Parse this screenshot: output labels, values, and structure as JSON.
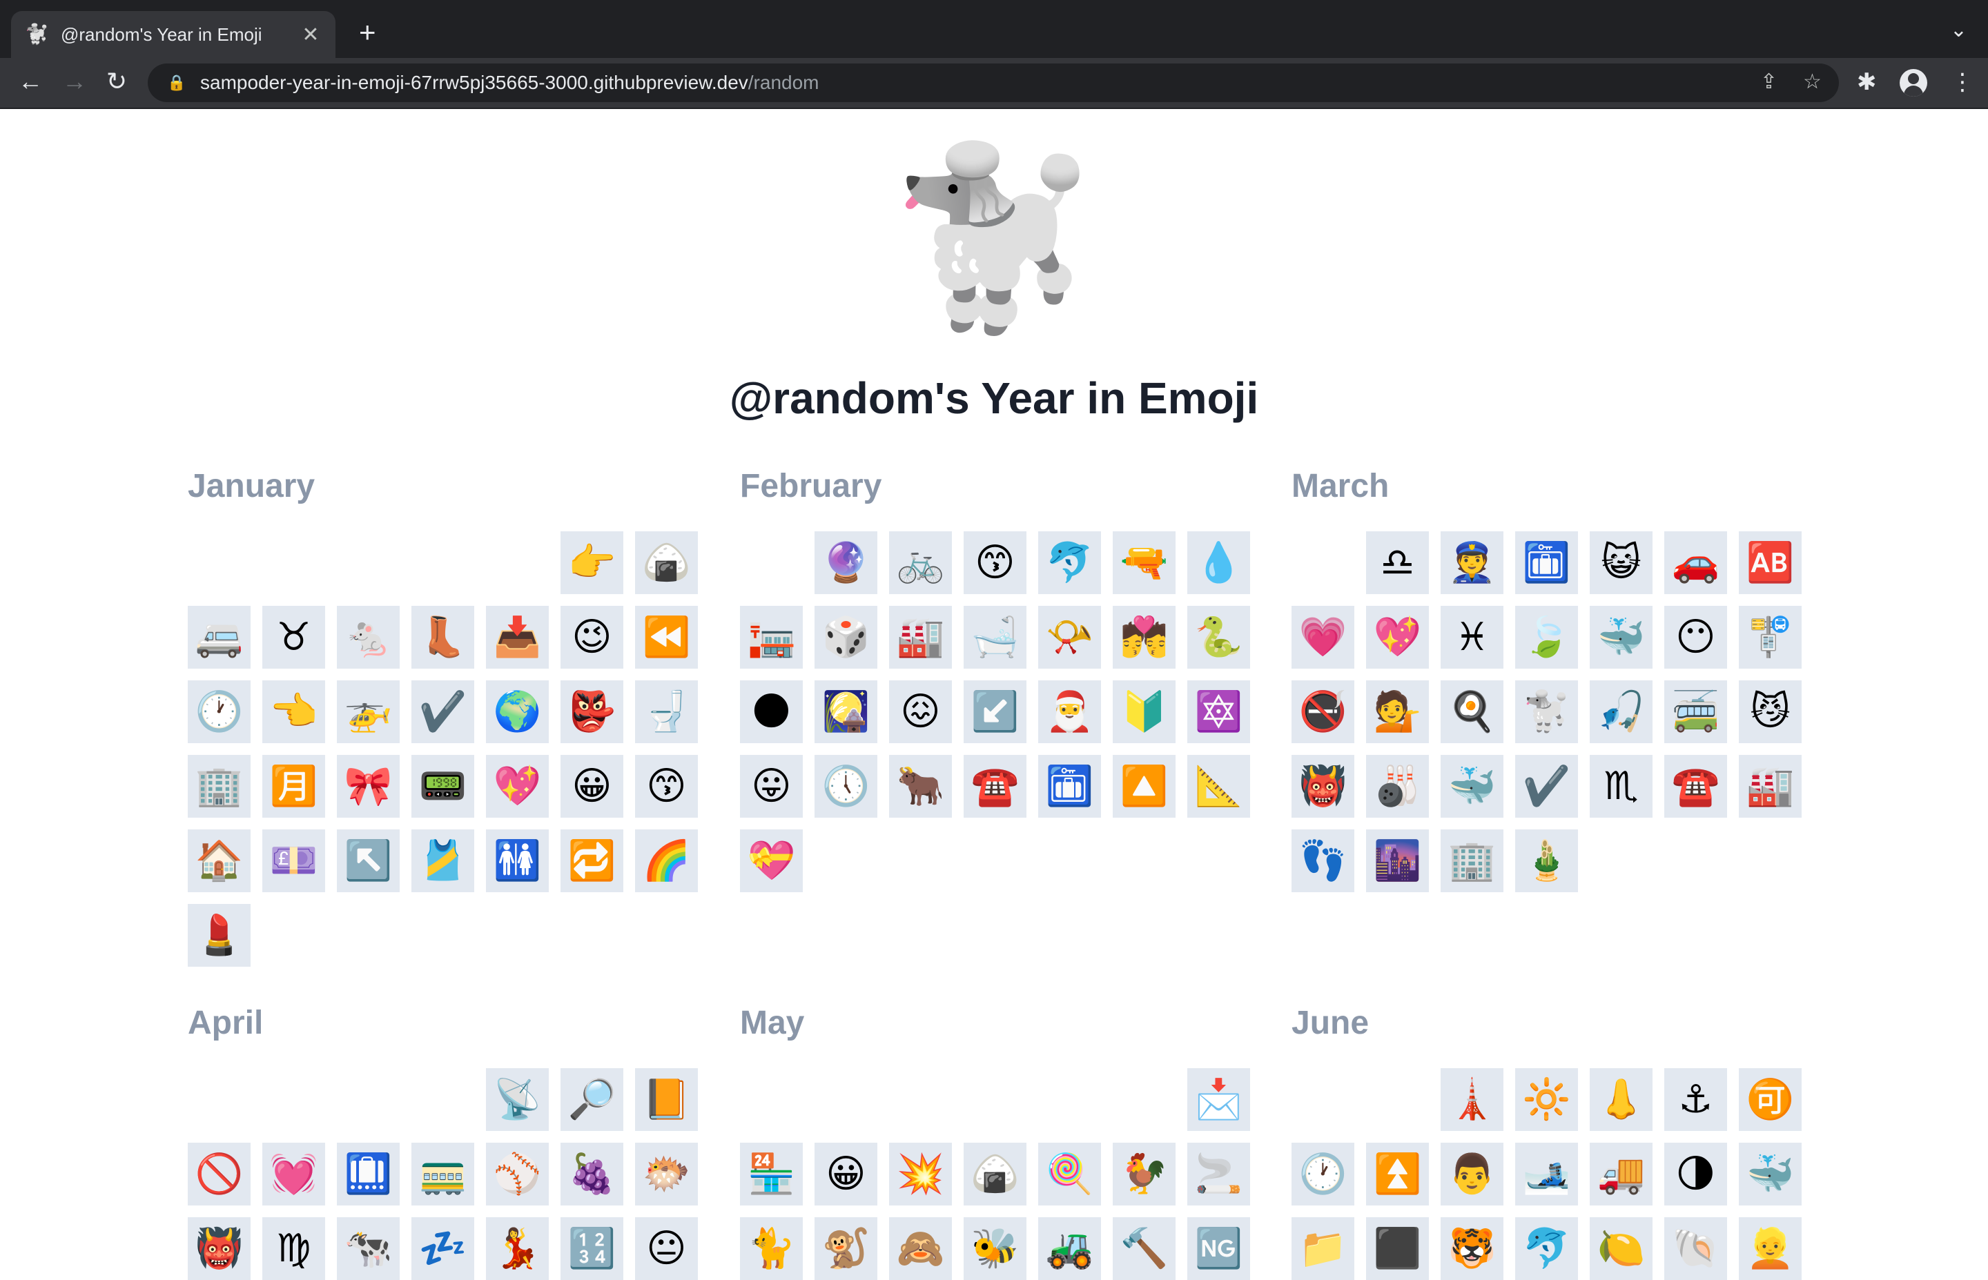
{
  "browser": {
    "tab": {
      "favicon": "🐩",
      "title": "@random's Year in Emoji",
      "close": "✕"
    },
    "new_tab": "+",
    "tab_menu": "⌄",
    "nav": {
      "back": "←",
      "forward": "→",
      "reload": "↻"
    },
    "url": {
      "host": "sampoder-year-in-emoji-67rrw5pj35665-3000.githubpreview.dev",
      "path": "/random"
    },
    "icons": {
      "lock": "🔒",
      "share": "⇪",
      "bookmark": "☆",
      "extensions": "✱",
      "menu": "⋮"
    }
  },
  "page": {
    "hero_emoji": "🐩",
    "title": "@random's Year in Emoji"
  },
  "months": [
    {
      "name": "January",
      "offset": 5,
      "emojis": [
        "👉",
        "🍙",
        "🚐",
        "♉",
        "🐁",
        "👢",
        "📥",
        "😉",
        "⏪",
        "🕐",
        "👈",
        "🚁",
        "✔️",
        "🌍",
        "👺",
        "🚽",
        "🏢",
        "🈷️",
        "🎀",
        "📟",
        "💖",
        "😀",
        "😙",
        "🏠",
        "💷",
        "↖️",
        "🎽",
        "🚻",
        "🔁",
        "🌈",
        "💄"
      ]
    },
    {
      "name": "February",
      "offset": 1,
      "emojis": [
        "🔮",
        "🚲",
        "😙",
        "🐬",
        "🔫",
        "💧",
        "🏣",
        "🎲",
        "🏭",
        "🛁",
        "📯",
        "💏",
        "🐍",
        "🌑",
        "🎑",
        "😖",
        "↙️",
        "🎅",
        "🔰",
        "🔯",
        "😛",
        "🕔",
        "🐂",
        "☎️",
        "🛅",
        "🔼",
        "📐",
        "💝"
      ]
    },
    {
      "name": "March",
      "offset": 1,
      "emojis": [
        "♎",
        "👮",
        "🛅",
        "😺",
        "🚗",
        "🆎",
        "💗",
        "💖",
        "♓",
        "🍃",
        "🐳",
        "😶",
        "🚏",
        "🚭",
        "💁",
        "🍳",
        "🐩",
        "🎣",
        "🚎",
        "😼",
        "👹",
        "🎳",
        "🐳",
        "✔️",
        "♏",
        "☎️",
        "🏭",
        "👣",
        "🌆",
        "🏢",
        "🎍"
      ]
    },
    {
      "name": "April",
      "offset": 4,
      "emojis": [
        "📡",
        "🔎",
        "📙",
        "🚫",
        "💓",
        "🛄",
        "🚃",
        "⚾",
        "🍇",
        "🐡",
        "👹",
        "♍",
        "🐄",
        "💤",
        "💃",
        "🔢",
        "😐"
      ]
    },
    {
      "name": "May",
      "offset": 6,
      "emojis": [
        "📩",
        "🏪",
        "😀",
        "💥",
        "🍙",
        "🍭",
        "🐓",
        "🚬",
        "🐈",
        "🐒",
        "🙈",
        "🐝",
        "🚜",
        "🔨",
        "🆖"
      ]
    },
    {
      "name": "June",
      "offset": 2,
      "emojis": [
        "🗼",
        "🔆",
        "👃",
        "⚓",
        "🉑",
        "🕐",
        "⏫",
        "👨",
        "🎿",
        "🚚",
        "🌗",
        "🐳",
        "📁",
        "⬛",
        "🐯",
        "🐬",
        "🍋",
        "🐚",
        "👱"
      ]
    }
  ]
}
